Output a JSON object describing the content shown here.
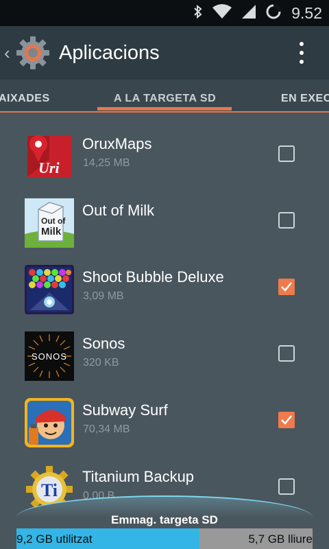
{
  "status_bar": {
    "time": "9.52",
    "icons": [
      "bluetooth-icon",
      "wifi-icon",
      "signal-icon",
      "battery-charging-icon"
    ]
  },
  "action_bar": {
    "title": "Aplicacions",
    "up_icon": "chevron-left-icon",
    "app_icon": "settings-gear-icon",
    "overflow_icon": "overflow-menu-icon"
  },
  "tabs": [
    {
      "label": "AIXADES",
      "active": false
    },
    {
      "label": "A LA TARGETA SD",
      "active": true
    },
    {
      "label": "EN EXEC",
      "active": false
    }
  ],
  "apps": [
    {
      "name": "OruxMaps",
      "size": "14,25 MB",
      "checked": false,
      "icon": "oruxmaps-icon"
    },
    {
      "name": "Out of Milk",
      "size": "",
      "checked": false,
      "icon": "out-of-milk-icon",
      "icon_text": "Out of Milk"
    },
    {
      "name": "Shoot Bubble Deluxe",
      "size": "3,09 MB",
      "checked": true,
      "icon": "shoot-bubble-icon"
    },
    {
      "name": "Sonos",
      "size": "320 KB",
      "checked": false,
      "icon": "sonos-icon",
      "icon_text": "SONOS"
    },
    {
      "name": "Subway Surf",
      "size": "70,34 MB",
      "checked": true,
      "icon": "subway-surf-icon"
    },
    {
      "name": "Titanium Backup",
      "size": "0,00 B",
      "checked": false,
      "icon": "titanium-backup-icon"
    }
  ],
  "storage": {
    "label": "Emmag. targeta SD",
    "used_text": "9,2 GB utilitzat",
    "free_text": "5,7 GB lliure",
    "used_fraction": 0.617,
    "used_color": "#33b5e5",
    "free_color": "#999999"
  },
  "colors": {
    "accent": "#e8764a",
    "checkbox_checked": "#ef7a4c"
  }
}
